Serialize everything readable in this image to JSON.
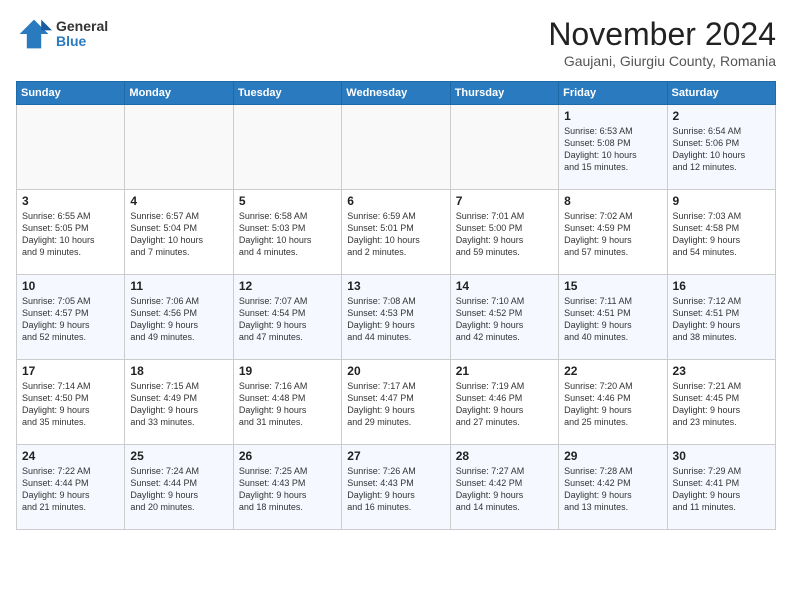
{
  "logo": {
    "general": "General",
    "blue": "Blue"
  },
  "title": "November 2024",
  "location": "Gaujani, Giurgiu County, Romania",
  "weekdays": [
    "Sunday",
    "Monday",
    "Tuesday",
    "Wednesday",
    "Thursday",
    "Friday",
    "Saturday"
  ],
  "weeks": [
    [
      {
        "day": "",
        "info": ""
      },
      {
        "day": "",
        "info": ""
      },
      {
        "day": "",
        "info": ""
      },
      {
        "day": "",
        "info": ""
      },
      {
        "day": "",
        "info": ""
      },
      {
        "day": "1",
        "info": "Sunrise: 6:53 AM\nSunset: 5:08 PM\nDaylight: 10 hours\nand 15 minutes."
      },
      {
        "day": "2",
        "info": "Sunrise: 6:54 AM\nSunset: 5:06 PM\nDaylight: 10 hours\nand 12 minutes."
      }
    ],
    [
      {
        "day": "3",
        "info": "Sunrise: 6:55 AM\nSunset: 5:05 PM\nDaylight: 10 hours\nand 9 minutes."
      },
      {
        "day": "4",
        "info": "Sunrise: 6:57 AM\nSunset: 5:04 PM\nDaylight: 10 hours\nand 7 minutes."
      },
      {
        "day": "5",
        "info": "Sunrise: 6:58 AM\nSunset: 5:03 PM\nDaylight: 10 hours\nand 4 minutes."
      },
      {
        "day": "6",
        "info": "Sunrise: 6:59 AM\nSunset: 5:01 PM\nDaylight: 10 hours\nand 2 minutes."
      },
      {
        "day": "7",
        "info": "Sunrise: 7:01 AM\nSunset: 5:00 PM\nDaylight: 9 hours\nand 59 minutes."
      },
      {
        "day": "8",
        "info": "Sunrise: 7:02 AM\nSunset: 4:59 PM\nDaylight: 9 hours\nand 57 minutes."
      },
      {
        "day": "9",
        "info": "Sunrise: 7:03 AM\nSunset: 4:58 PM\nDaylight: 9 hours\nand 54 minutes."
      }
    ],
    [
      {
        "day": "10",
        "info": "Sunrise: 7:05 AM\nSunset: 4:57 PM\nDaylight: 9 hours\nand 52 minutes."
      },
      {
        "day": "11",
        "info": "Sunrise: 7:06 AM\nSunset: 4:56 PM\nDaylight: 9 hours\nand 49 minutes."
      },
      {
        "day": "12",
        "info": "Sunrise: 7:07 AM\nSunset: 4:54 PM\nDaylight: 9 hours\nand 47 minutes."
      },
      {
        "day": "13",
        "info": "Sunrise: 7:08 AM\nSunset: 4:53 PM\nDaylight: 9 hours\nand 44 minutes."
      },
      {
        "day": "14",
        "info": "Sunrise: 7:10 AM\nSunset: 4:52 PM\nDaylight: 9 hours\nand 42 minutes."
      },
      {
        "day": "15",
        "info": "Sunrise: 7:11 AM\nSunset: 4:51 PM\nDaylight: 9 hours\nand 40 minutes."
      },
      {
        "day": "16",
        "info": "Sunrise: 7:12 AM\nSunset: 4:51 PM\nDaylight: 9 hours\nand 38 minutes."
      }
    ],
    [
      {
        "day": "17",
        "info": "Sunrise: 7:14 AM\nSunset: 4:50 PM\nDaylight: 9 hours\nand 35 minutes."
      },
      {
        "day": "18",
        "info": "Sunrise: 7:15 AM\nSunset: 4:49 PM\nDaylight: 9 hours\nand 33 minutes."
      },
      {
        "day": "19",
        "info": "Sunrise: 7:16 AM\nSunset: 4:48 PM\nDaylight: 9 hours\nand 31 minutes."
      },
      {
        "day": "20",
        "info": "Sunrise: 7:17 AM\nSunset: 4:47 PM\nDaylight: 9 hours\nand 29 minutes."
      },
      {
        "day": "21",
        "info": "Sunrise: 7:19 AM\nSunset: 4:46 PM\nDaylight: 9 hours\nand 27 minutes."
      },
      {
        "day": "22",
        "info": "Sunrise: 7:20 AM\nSunset: 4:46 PM\nDaylight: 9 hours\nand 25 minutes."
      },
      {
        "day": "23",
        "info": "Sunrise: 7:21 AM\nSunset: 4:45 PM\nDaylight: 9 hours\nand 23 minutes."
      }
    ],
    [
      {
        "day": "24",
        "info": "Sunrise: 7:22 AM\nSunset: 4:44 PM\nDaylight: 9 hours\nand 21 minutes."
      },
      {
        "day": "25",
        "info": "Sunrise: 7:24 AM\nSunset: 4:44 PM\nDaylight: 9 hours\nand 20 minutes."
      },
      {
        "day": "26",
        "info": "Sunrise: 7:25 AM\nSunset: 4:43 PM\nDaylight: 9 hours\nand 18 minutes."
      },
      {
        "day": "27",
        "info": "Sunrise: 7:26 AM\nSunset: 4:43 PM\nDaylight: 9 hours\nand 16 minutes."
      },
      {
        "day": "28",
        "info": "Sunrise: 7:27 AM\nSunset: 4:42 PM\nDaylight: 9 hours\nand 14 minutes."
      },
      {
        "day": "29",
        "info": "Sunrise: 7:28 AM\nSunset: 4:42 PM\nDaylight: 9 hours\nand 13 minutes."
      },
      {
        "day": "30",
        "info": "Sunrise: 7:29 AM\nSunset: 4:41 PM\nDaylight: 9 hours\nand 11 minutes."
      }
    ]
  ]
}
